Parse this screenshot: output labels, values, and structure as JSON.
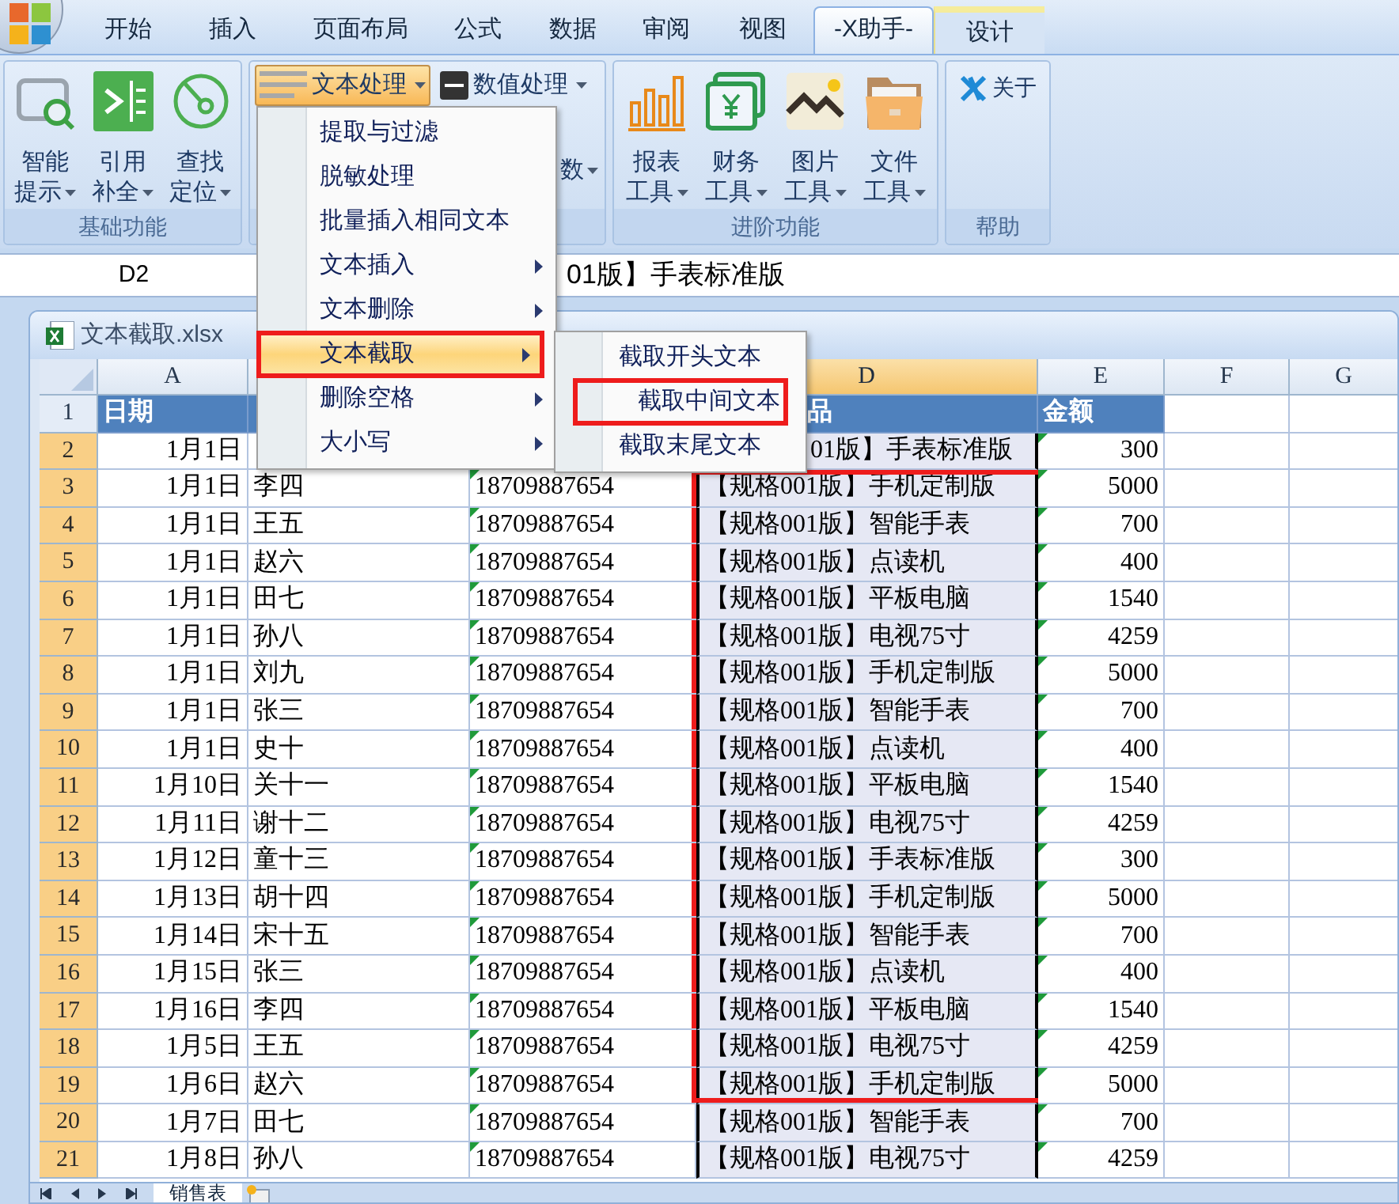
{
  "tabs": [
    {
      "label": "开始",
      "selected": false,
      "kind": "normal"
    },
    {
      "label": "插入",
      "selected": false,
      "kind": "normal"
    },
    {
      "label": "页面布局",
      "selected": false,
      "kind": "normal"
    },
    {
      "label": "公式",
      "selected": false,
      "kind": "normal"
    },
    {
      "label": "数据",
      "selected": false,
      "kind": "normal"
    },
    {
      "label": "审阅",
      "selected": false,
      "kind": "normal"
    },
    {
      "label": "视图",
      "selected": false,
      "kind": "normal"
    },
    {
      "label": "-X助手-",
      "selected": true,
      "kind": "normal"
    },
    {
      "label": "设计",
      "selected": false,
      "kind": "contextual"
    }
  ],
  "ribbon": {
    "basic": {
      "label": "基础功能",
      "buttons": [
        {
          "line1": "智能",
          "line2": "提示",
          "dropdown": true
        },
        {
          "line1": "引用",
          "line2": "补全",
          "dropdown": true
        },
        {
          "line1": "查找",
          "line2": "定位",
          "dropdown": true
        }
      ]
    },
    "text_group": {
      "buttons": [
        {
          "label": "文本处理",
          "dropdown": true,
          "pressed": true
        },
        {
          "label": "数值处理",
          "dropdown": true,
          "pressed": false
        }
      ],
      "partial_label": "数"
    },
    "advanced": {
      "label": "进阶功能",
      "buttons": [
        {
          "line1": "报表",
          "line2": "工具",
          "dropdown": true
        },
        {
          "line1": "财务",
          "line2": "工具",
          "dropdown": true
        },
        {
          "line1": "图片",
          "line2": "工具",
          "dropdown": true
        },
        {
          "line1": "文件",
          "line2": "工具",
          "dropdown": true
        }
      ]
    },
    "help": {
      "label": "帮助",
      "button": "关于"
    }
  },
  "formula_bar": {
    "name_box": "D2",
    "formula": "01版】手表标准版"
  },
  "menu": {
    "items": [
      {
        "label": "提取与过滤",
        "has_submenu": false,
        "hovered": false,
        "annotated": false
      },
      {
        "label": "脱敏处理",
        "has_submenu": false,
        "hovered": false,
        "annotated": false
      },
      {
        "label": "批量插入相同文本",
        "has_submenu": false,
        "hovered": false,
        "annotated": false
      },
      {
        "label": "文本插入",
        "has_submenu": true,
        "hovered": false,
        "annotated": false
      },
      {
        "label": "文本删除",
        "has_submenu": true,
        "hovered": false,
        "annotated": false
      },
      {
        "label": "文本截取",
        "has_submenu": true,
        "hovered": true,
        "annotated": true
      },
      {
        "label": "删除空格",
        "has_submenu": true,
        "hovered": false,
        "annotated": false
      },
      {
        "label": "大小写",
        "has_submenu": true,
        "hovered": false,
        "annotated": false
      }
    ]
  },
  "submenu": {
    "items": [
      {
        "label": "截取开头文本",
        "annotated": false
      },
      {
        "label": "截取中间文本",
        "annotated": true
      },
      {
        "label": "截取末尾文本",
        "annotated": false
      }
    ]
  },
  "workbook": {
    "title": "文本截取.xlsx",
    "columns": [
      {
        "label": "A",
        "selected": false
      },
      {},
      {},
      {
        "label": "D",
        "selected": true
      },
      {
        "label": "E",
        "selected": false
      },
      {
        "label": "F",
        "selected": false
      },
      {
        "label": "G",
        "selected": false
      }
    ],
    "rows": [
      {
        "number": "1",
        "kind": "header",
        "a": "日期",
        "d": "品",
        "e": "金额",
        "selected": false,
        "highlighted": false,
        "text_flag": false
      },
      {
        "number": "2",
        "kind": "data",
        "a": "1月1日",
        "d": "01版】手表标准版",
        "e": "300",
        "selected": true,
        "highlighted": false,
        "text_flag": true
      },
      {
        "number": "3",
        "kind": "data",
        "a": "1月1日",
        "b": "李四",
        "c": "18709887654",
        "d": "【规格001版】手机定制版",
        "e": "5000",
        "selected": true,
        "highlighted": true,
        "text_flag": true
      },
      {
        "number": "4",
        "kind": "data",
        "a": "1月1日",
        "b": "王五",
        "c": "18709887654",
        "d": "【规格001版】智能手表",
        "e": "700",
        "selected": true,
        "highlighted": true,
        "text_flag": true
      },
      {
        "number": "5",
        "kind": "data",
        "a": "1月1日",
        "b": "赵六",
        "c": "18709887654",
        "d": "【规格001版】点读机",
        "e": "400",
        "selected": true,
        "highlighted": true,
        "text_flag": true
      },
      {
        "number": "6",
        "kind": "data",
        "a": "1月1日",
        "b": "田七",
        "c": "18709887654",
        "d": "【规格001版】平板电脑",
        "e": "1540",
        "selected": true,
        "highlighted": true,
        "text_flag": true
      },
      {
        "number": "7",
        "kind": "data",
        "a": "1月1日",
        "b": "孙八",
        "c": "18709887654",
        "d": "【规格001版】电视75寸",
        "e": "4259",
        "selected": true,
        "highlighted": true,
        "text_flag": true
      },
      {
        "number": "8",
        "kind": "data",
        "a": "1月1日",
        "b": "刘九",
        "c": "18709887654",
        "d": "【规格001版】手机定制版",
        "e": "5000",
        "selected": true,
        "highlighted": true,
        "text_flag": true
      },
      {
        "number": "9",
        "kind": "data",
        "a": "1月1日",
        "b": "张三",
        "c": "18709887654",
        "d": "【规格001版】智能手表",
        "e": "700",
        "selected": true,
        "highlighted": true,
        "text_flag": true
      },
      {
        "number": "10",
        "kind": "data",
        "a": "1月1日",
        "b": "史十",
        "c": "18709887654",
        "d": "【规格001版】点读机",
        "e": "400",
        "selected": true,
        "highlighted": true,
        "text_flag": true
      },
      {
        "number": "11",
        "kind": "data",
        "a": "1月10日",
        "b": "关十一",
        "c": "18709887654",
        "d": "【规格001版】平板电脑",
        "e": "1540",
        "selected": true,
        "highlighted": true,
        "text_flag": true
      },
      {
        "number": "12",
        "kind": "data",
        "a": "1月11日",
        "b": "谢十二",
        "c": "18709887654",
        "d": "【规格001版】电视75寸",
        "e": "4259",
        "selected": true,
        "highlighted": true,
        "text_flag": true
      },
      {
        "number": "13",
        "kind": "data",
        "a": "1月12日",
        "b": "童十三",
        "c": "18709887654",
        "d": "【规格001版】手表标准版",
        "e": "300",
        "selected": true,
        "highlighted": true,
        "text_flag": true
      },
      {
        "number": "14",
        "kind": "data",
        "a": "1月13日",
        "b": "胡十四",
        "c": "18709887654",
        "d": "【规格001版】手机定制版",
        "e": "5000",
        "selected": true,
        "highlighted": true,
        "text_flag": true
      },
      {
        "number": "15",
        "kind": "data",
        "a": "1月14日",
        "b": "宋十五",
        "c": "18709887654",
        "d": "【规格001版】智能手表",
        "e": "700",
        "selected": true,
        "highlighted": true,
        "text_flag": true
      },
      {
        "number": "16",
        "kind": "data",
        "a": "1月15日",
        "b": "张三",
        "c": "18709887654",
        "d": "【规格001版】点读机",
        "e": "400",
        "selected": true,
        "highlighted": true,
        "text_flag": true
      },
      {
        "number": "17",
        "kind": "data",
        "a": "1月16日",
        "b": "李四",
        "c": "18709887654",
        "d": "【规格001版】平板电脑",
        "e": "1540",
        "selected": true,
        "highlighted": true,
        "text_flag": true
      },
      {
        "number": "18",
        "kind": "data",
        "a": "1月5日",
        "b": "王五",
        "c": "18709887654",
        "d": "【规格001版】电视75寸",
        "e": "4259",
        "selected": true,
        "highlighted": true,
        "text_flag": true
      },
      {
        "number": "19",
        "kind": "data",
        "a": "1月6日",
        "b": "赵六",
        "c": "18709887654",
        "d": "【规格001版】手机定制版",
        "e": "5000",
        "selected": true,
        "highlighted": true,
        "text_flag": true
      },
      {
        "number": "20",
        "kind": "data",
        "a": "1月7日",
        "b": "田七",
        "c": "18709887654",
        "d": "【规格001版】智能手表",
        "e": "700",
        "selected": true,
        "highlighted": false,
        "text_flag": true
      },
      {
        "number": "21",
        "kind": "data",
        "a": "1月8日",
        "b": "孙八",
        "c": "18709887654",
        "d": "【规格001版】电视75寸",
        "e": "4259",
        "selected": true,
        "highlighted": false,
        "text_flag": true
      }
    ],
    "sheet_tabs": [
      {
        "label": "销售表",
        "selected": true
      }
    ]
  }
}
